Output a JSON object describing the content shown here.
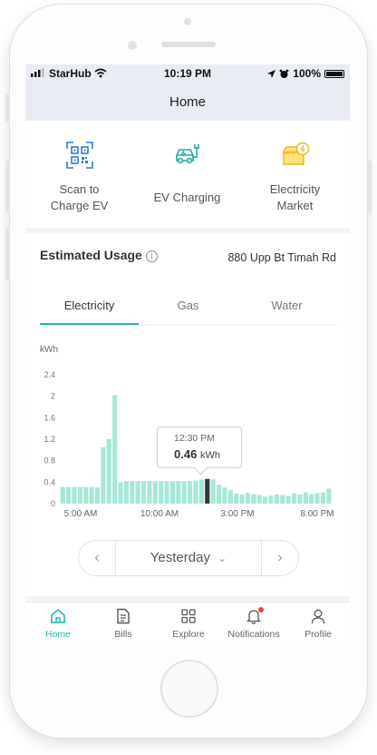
{
  "status_bar": {
    "carrier": "StarHub",
    "time": "10:19 PM",
    "battery": "100%"
  },
  "header": {
    "title": "Home"
  },
  "quick_actions": [
    {
      "label_line1": "Scan to",
      "label_line2": "Charge EV",
      "icon": "qr-code-icon"
    },
    {
      "label_line1": "EV Charging",
      "label_line2": "",
      "icon": "ev-car-charging-icon"
    },
    {
      "label_line1": "Electricity",
      "label_line2": "Market",
      "icon": "electricity-market-icon"
    }
  ],
  "usage": {
    "title": "Estimated Usage",
    "info_glyph": "i",
    "address": "880 Upp Bt Timah Rd"
  },
  "tabs": [
    {
      "label": "Electricity",
      "active": true
    },
    {
      "label": "Gas",
      "active": false
    },
    {
      "label": "Water",
      "active": false
    }
  ],
  "tooltip": {
    "time": "12:30 PM",
    "value": "0.46",
    "unit": "kWh"
  },
  "date_selector": {
    "label": "Yesterday",
    "prev": "‹",
    "next": "›",
    "caret": "⌄"
  },
  "colors": {
    "accent": "#22b6b0",
    "bar": "#a8e7d8",
    "selected_bar": "#2f3b37"
  },
  "chart_data": {
    "type": "bar",
    "ylabel": "kWh",
    "yticks": [
      "2.4",
      "2",
      "1.6",
      "1.2",
      "0.8",
      "0.4",
      "0"
    ],
    "ylim": [
      0,
      2.4
    ],
    "xtick_labels": [
      "5:00 AM",
      "10:00 AM",
      "3:00 PM",
      "8:00 PM"
    ],
    "grid": false,
    "selected_index": 25,
    "values": [
      0.31,
      0.31,
      0.31,
      0.31,
      0.31,
      0.31,
      0.3,
      1.05,
      1.2,
      2.02,
      0.4,
      0.42,
      0.42,
      0.42,
      0.42,
      0.42,
      0.42,
      0.42,
      0.42,
      0.42,
      0.42,
      0.42,
      0.42,
      0.43,
      0.45,
      0.46,
      0.45,
      0.35,
      0.3,
      0.25,
      0.19,
      0.17,
      0.2,
      0.18,
      0.16,
      0.13,
      0.15,
      0.17,
      0.16,
      0.14,
      0.19,
      0.17,
      0.21,
      0.18,
      0.2,
      0.21,
      0.28
    ]
  },
  "tab_bar": [
    {
      "label": "Home",
      "icon": "home-icon",
      "active": true
    },
    {
      "label": "Bills",
      "icon": "bills-document-icon",
      "active": false
    },
    {
      "label": "Explore",
      "icon": "explore-grid-icon",
      "active": false
    },
    {
      "label": "Notifications",
      "icon": "bell-icon",
      "active": false,
      "badge": true
    },
    {
      "label": "Profile",
      "icon": "profile-icon",
      "active": false
    }
  ]
}
